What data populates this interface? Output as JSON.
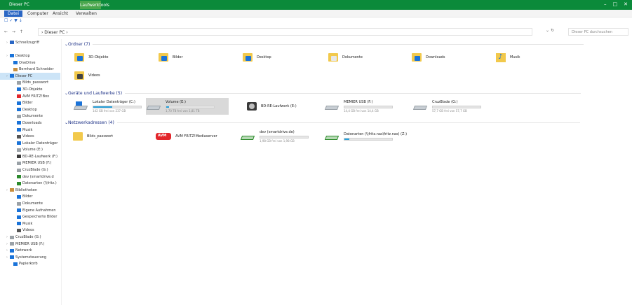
{
  "window": {
    "title": "Dieser PC",
    "tools_tab": "Laufwerktools",
    "min": "–",
    "max": "□",
    "close": "✕"
  },
  "ribbon": {
    "tabs": [
      "Datei",
      "Computer",
      "Ansicht",
      "Verwalten"
    ]
  },
  "qat": "☐ ✓ ▼ ↓",
  "addressbar": {
    "nav": "← → ↑",
    "path": "› Dieser PC ›",
    "refresh": "⌄ ↻",
    "search_placeholder": "Dieser PC durchsuchen"
  },
  "sidebar": {
    "items": [
      {
        "label": "Schnellzugriff",
        "indent": 1,
        "icon": "star-icon",
        "color": "#2a66c4"
      },
      {
        "label": "",
        "indent": 0
      },
      {
        "label": "Desktop",
        "indent": 1,
        "icon": "desktop-icon",
        "color": "#1a73d9"
      },
      {
        "label": "OneDrive",
        "indent": 2,
        "icon": "cloud-icon",
        "color": "#1a73d9"
      },
      {
        "label": "Bernhard Schneider",
        "indent": 2,
        "icon": "user-icon",
        "color": "#c98f3d"
      },
      {
        "label": "Dieser PC",
        "indent": 1,
        "icon": "pc-icon",
        "color": "#1a73d9",
        "selected": true
      },
      {
        "label": "Bilds_passwort",
        "indent": 3,
        "icon": "file-icon",
        "color": "#9aa1a7"
      },
      {
        "label": "3D-Objekte",
        "indent": 3,
        "icon": "cube-icon",
        "color": "#1a73d9"
      },
      {
        "label": "AVM FRITZ!Box",
        "indent": 3,
        "icon": "router-icon",
        "color": "#e3262b"
      },
      {
        "label": "Bilder",
        "indent": 3,
        "icon": "picture-icon",
        "color": "#1a73d9"
      },
      {
        "label": "Desktop",
        "indent": 3,
        "icon": "desktop-icon",
        "color": "#1a73d9"
      },
      {
        "label": "Dokumente",
        "indent": 3,
        "icon": "doc-icon",
        "color": "#9aa1a7"
      },
      {
        "label": "Downloads",
        "indent": 3,
        "icon": "download-icon",
        "color": "#1a73d9"
      },
      {
        "label": "Musik",
        "indent": 3,
        "icon": "music-icon",
        "color": "#1a73d9"
      },
      {
        "label": "Videos",
        "indent": 3,
        "icon": "video-icon",
        "color": "#555"
      },
      {
        "label": "Lokaler Datenträger",
        "indent": 3,
        "icon": "drive-icon",
        "color": "#1a73d9"
      },
      {
        "label": "Volume (E:)",
        "indent": 3,
        "icon": "drive-icon",
        "color": "#9aa1a7"
      },
      {
        "label": "BD-RE-Laufwerk (F:)",
        "indent": 3,
        "icon": "dvd-icon",
        "color": "#3a3a3a"
      },
      {
        "label": "MEMIER USB (F:)",
        "indent": 3,
        "icon": "usb-icon",
        "color": "#9aa1a7"
      },
      {
        "label": "CruzBlade (G:)",
        "indent": 3,
        "icon": "usb-icon",
        "color": "#9aa1a7"
      },
      {
        "label": "dev (smartdrive.d",
        "indent": 3,
        "icon": "netdrive-icon",
        "color": "#2c8a2c"
      },
      {
        "label": "Datenarten (\\\\fritz.)",
        "indent": 3,
        "icon": "netdrive-icon",
        "color": "#2c8a2c"
      },
      {
        "label": "Bibliotheken",
        "indent": 1,
        "icon": "library-icon",
        "color": "#c98f3d"
      },
      {
        "label": "Bilder",
        "indent": 3,
        "icon": "picture-icon",
        "color": "#1a73d9"
      },
      {
        "label": "Dokumente",
        "indent": 3,
        "icon": "doc-icon",
        "color": "#9aa1a7"
      },
      {
        "label": "Eigene Aufnahmen",
        "indent": 3,
        "icon": "camera-icon",
        "color": "#1a73d9"
      },
      {
        "label": "Gespeicherte Bilder",
        "indent": 3,
        "icon": "picture-icon",
        "color": "#1a73d9"
      },
      {
        "label": "Musik",
        "indent": 3,
        "icon": "music-icon",
        "color": "#1a73d9"
      },
      {
        "label": "Videos",
        "indent": 3,
        "icon": "video-icon",
        "color": "#555"
      },
      {
        "label": "CruzBlade (G:)",
        "indent": 1,
        "icon": "usb-icon",
        "color": "#9aa1a7"
      },
      {
        "label": "MEMIER USB (F:)",
        "indent": 1,
        "icon": "usb-icon",
        "color": "#9aa1a7"
      },
      {
        "label": "Netzwerk",
        "indent": 1,
        "icon": "network-icon",
        "color": "#1a73d9"
      },
      {
        "label": "Systemsteuerung",
        "indent": 1,
        "icon": "control-icon",
        "color": "#1a73d9"
      },
      {
        "label": "Papierkorb",
        "indent": 2,
        "icon": "recycle-icon",
        "color": "#1a73d9"
      }
    ]
  },
  "sections": {
    "folders": {
      "title": "Ordner (7)"
    },
    "drives": {
      "title": "Geräte und Laufwerke (5)"
    },
    "network": {
      "title": "Netzwerkadressen (4)"
    }
  },
  "folders": [
    {
      "label": "3D-Objekte",
      "icon": "cube-icon",
      "overlay": "#1a73d9"
    },
    {
      "label": "Bilder",
      "icon": "picture-icon",
      "overlay": "#1a73d9"
    },
    {
      "label": "Desktop",
      "icon": "desktop-icon",
      "overlay": "#1a73d9"
    },
    {
      "label": "Dokumente",
      "icon": "doc-icon",
      "overlay": "#e8e8e8"
    },
    {
      "label": "Downloads",
      "icon": "download-icon",
      "overlay": "#1a73d9"
    },
    {
      "label": "Musik",
      "icon": "music-icon",
      "overlay": "#1a73d9"
    },
    {
      "label": "Videos",
      "icon": "video-icon",
      "overlay": "#444"
    }
  ],
  "drives": [
    {
      "label": "Lokaler Datenträger (C:)",
      "free": "142 GB frei von 237 GB",
      "used": 0.4,
      "icon": "windows-drive-icon"
    },
    {
      "label": "Volume (E:)",
      "free": "1,70 TB frei von 1,81 TB",
      "used": 0.06,
      "icon": "drive-icon",
      "selected": true
    },
    {
      "label": "BD-RE-Laufwerk (E:)",
      "icon": "dvd-icon"
    },
    {
      "label": "MEMIER USB (F:)",
      "free": "14,4 GB frei von 14,4 GB",
      "used": 0.0,
      "icon": "usb-drive-icon"
    },
    {
      "label": "CruzBlade (G:)",
      "free": "57,7 GB frei von 57,7 GB",
      "used": 0.0,
      "icon": "usb-drive-icon"
    }
  ],
  "network": [
    {
      "label": "Bilds_passwort",
      "icon": "file-icon"
    },
    {
      "label": "AVM FRITZ!Mediaserver",
      "icon": "fritz-icon",
      "badge": "fritz"
    },
    {
      "label": "dev (smartdrive.de)",
      "free": "1,98 GB frei von 1,98 GB",
      "used": 0.0,
      "icon": "netdrive-icon"
    },
    {
      "label": "Datenarten (\\\\fritz.nas\\fritz.nas) (Z:)",
      "free": "",
      "used": 0.1,
      "icon": "netdrive-icon"
    }
  ]
}
